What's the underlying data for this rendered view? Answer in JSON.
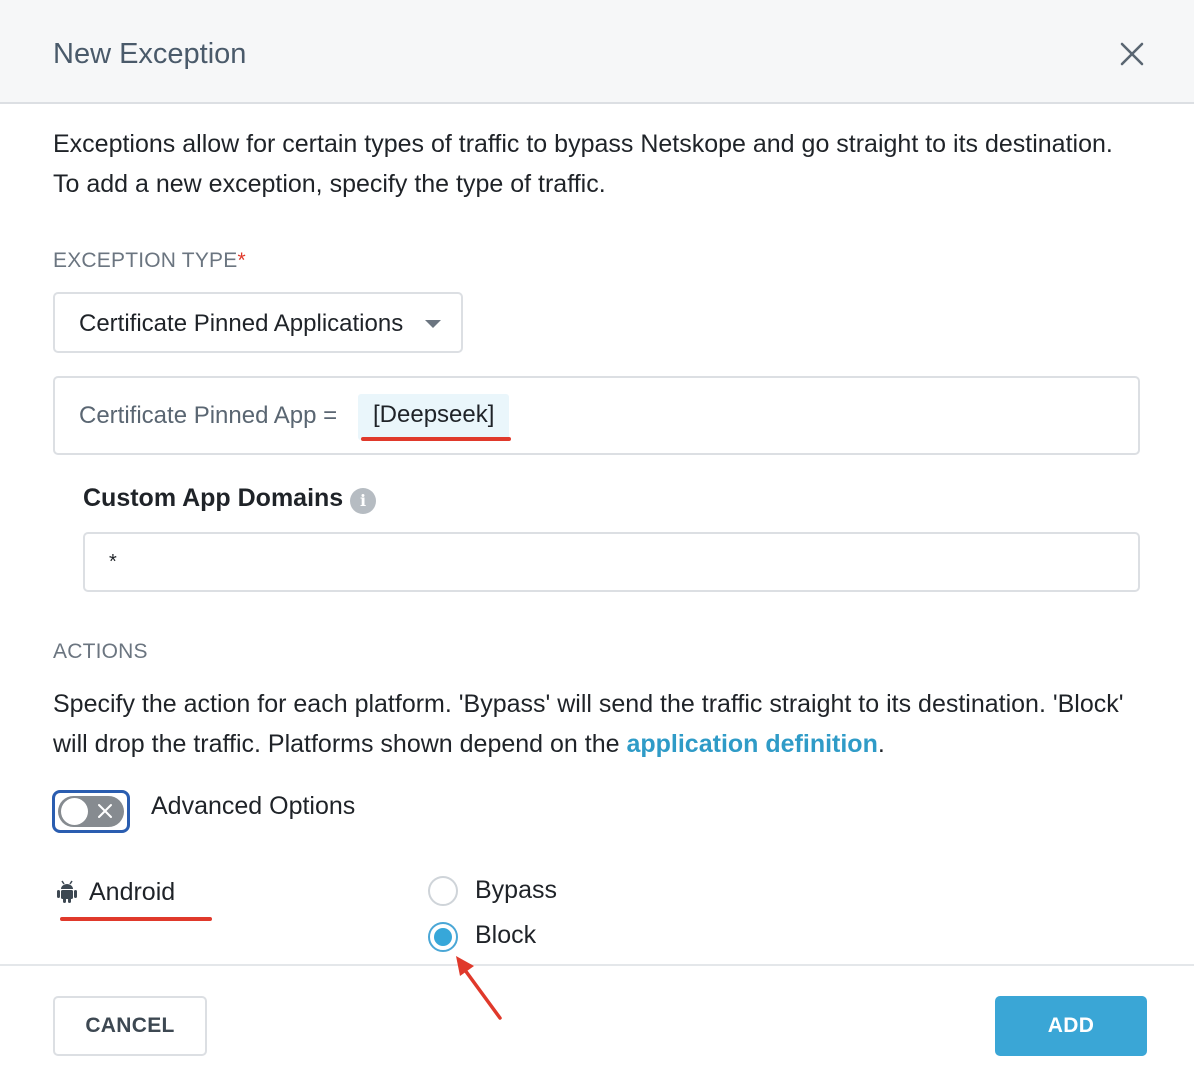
{
  "dialog": {
    "title": "New Exception",
    "intro": "Exceptions allow for certain types of traffic to bypass Netskope and go straight to its destination. To add a new exception, specify the type of traffic."
  },
  "exception_type": {
    "label": "EXCEPTION TYPE",
    "required_mark": "*",
    "selected_value": "Certificate Pinned Applications"
  },
  "criteria": {
    "label": "Certificate Pinned App =",
    "value": "[Deepseek]"
  },
  "custom_domains": {
    "label": "Custom App Domains",
    "info_icon": "info-icon",
    "value": "*"
  },
  "actions": {
    "label": "ACTIONS",
    "desc_before_link": "Specify the action for each platform. 'Bypass' will send the traffic straight to its destination. 'Block' will drop the traffic. Platforms shown depend on the ",
    "link_text": "application definition",
    "desc_after_link": "."
  },
  "advanced": {
    "label": "Advanced Options",
    "enabled": false
  },
  "platform": {
    "name": "Android",
    "icon": "android-icon",
    "options": [
      {
        "label": "Bypass",
        "selected": false
      },
      {
        "label": "Block",
        "selected": true
      }
    ]
  },
  "footer": {
    "cancel_label": "CANCEL",
    "add_label": "ADD"
  },
  "colors": {
    "accent": "#3aa6d6",
    "link": "#2f9bc7",
    "annotation_red": "#e0392b",
    "toggle_focus": "#2a5db0"
  }
}
